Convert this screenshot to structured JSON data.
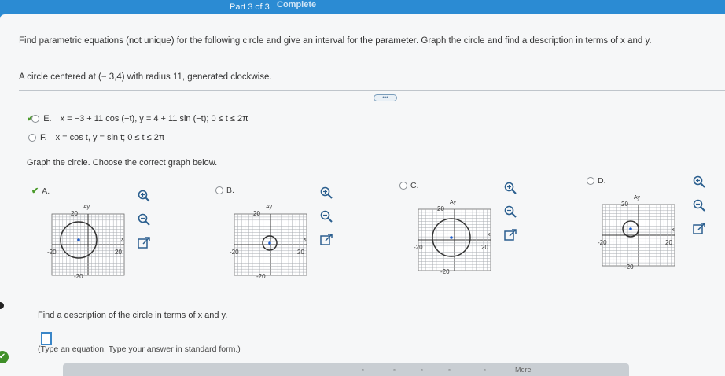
{
  "header": {
    "part_label": "Part 3 of 3",
    "status_label": "Complete"
  },
  "question": {
    "prompt": "Find parametric equations (not unique) for the following circle and give an interval for the parameter. Graph the circle and find a description in terms of x and y.",
    "circle": "A circle centered at (− 3,4) with radius 11, generated clockwise."
  },
  "options": [
    {
      "letter": "E.",
      "text": "x = −3 + 11 cos (−t), y = 4 + 11 sin (−t); 0 ≤ t ≤ 2π",
      "selected": true
    },
    {
      "letter": "F.",
      "text": "x = cos t, y = sin t; 0 ≤ t ≤ 2π",
      "selected": false
    }
  ],
  "graph_prompt": "Graph the circle. Choose the correct graph below.",
  "graph_choices": [
    {
      "letter": "A.",
      "selected": true,
      "y_top": "20",
      "y_bottom": "-20",
      "x_left": "-20",
      "x_right": "20",
      "x_axis": "x",
      "y_axis": "Ay"
    },
    {
      "letter": "B.",
      "selected": false,
      "y_top": "20",
      "y_bottom": "-20",
      "x_left": "-20",
      "x_right": "20",
      "x_axis": "x",
      "y_axis": "Ay"
    },
    {
      "letter": "C.",
      "selected": false,
      "y_top": "20",
      "y_bottom": "-20",
      "x_left": "-20",
      "x_right": "20",
      "x_axis": "x",
      "y_axis": "Ay"
    },
    {
      "letter": "D.",
      "selected": false,
      "y_top": "20",
      "y_bottom": "-20",
      "x_left": "-20",
      "x_right": "20",
      "x_axis": "x",
      "y_axis": "Ay"
    }
  ],
  "description_prompt": "Find a description of the circle in terms of x and y.",
  "answer_hint": "(Type an equation. Type your answer in standard form.)",
  "answer_value": "",
  "toolbar": {
    "more_label": "More"
  },
  "colors": {
    "accent": "#2b8bd3",
    "correct": "#4a9a2a",
    "grid": "#9aa0a6",
    "circle": "#333333",
    "center": "#1f5fd0"
  },
  "icons": [
    "zoom-in-icon",
    "zoom-out-icon",
    "external-link-icon",
    "check-icon"
  ]
}
